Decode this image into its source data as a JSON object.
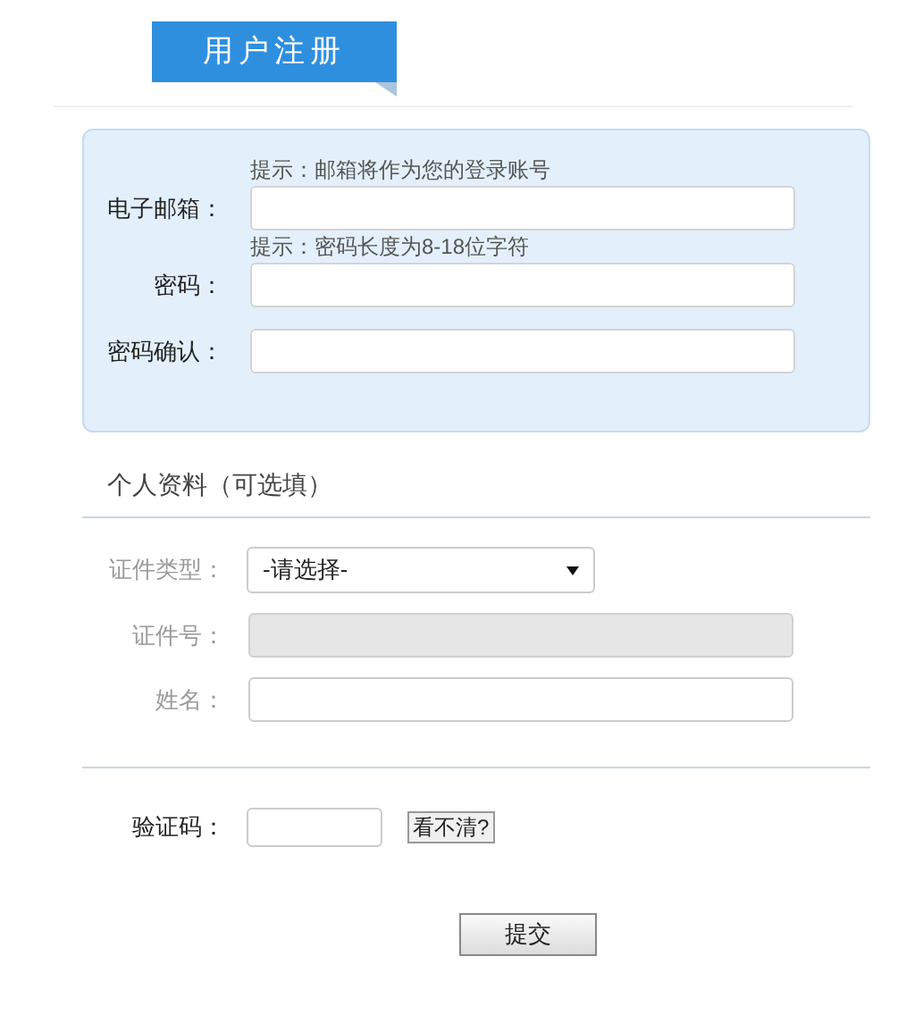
{
  "header_tab": "用户注册",
  "account_fields": [
    {
      "hint": "提示：邮箱将作为您的登录账号",
      "label": "电子邮箱："
    },
    {
      "hint": "提示：密码长度为8-18位字符",
      "label": "密码："
    },
    {
      "label": "密码确认："
    }
  ],
  "personal_section": {
    "title": "个人资料（可选填）",
    "fields": [
      {
        "kind": "select",
        "label": "证件类型：",
        "value": "-请选择-"
      },
      {
        "kind": "text",
        "label": "证件号：",
        "disabled": true
      },
      {
        "kind": "text",
        "label": "姓名：",
        "disabled": false
      }
    ]
  },
  "captcha": {
    "label": "验证码：",
    "refresh_button": "看不清?"
  },
  "submit_button": "提交"
}
